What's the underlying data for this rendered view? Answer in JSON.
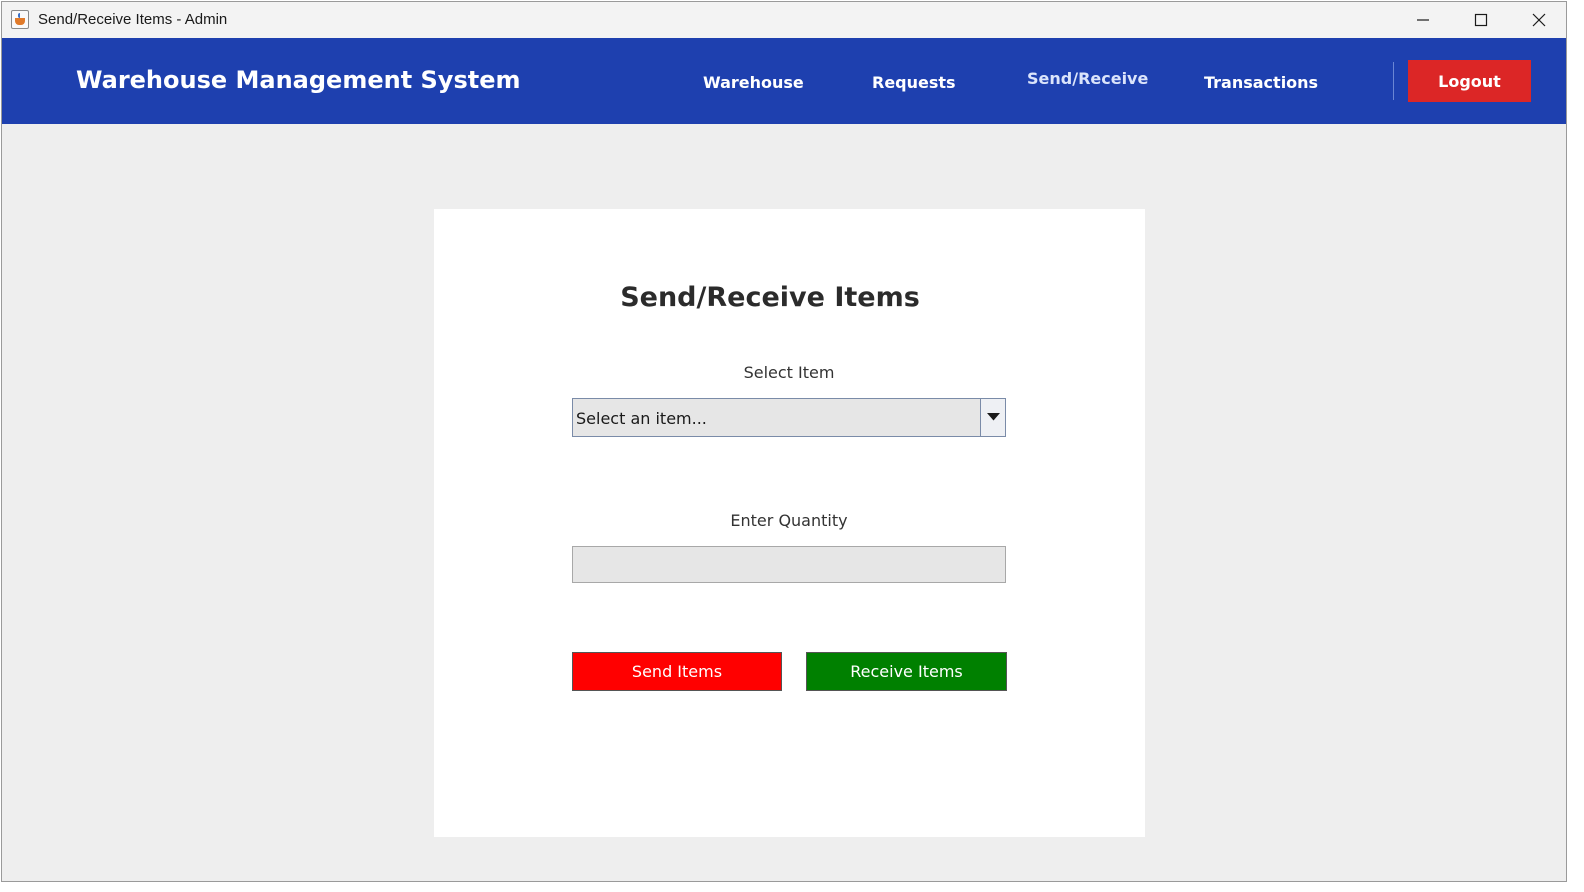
{
  "window": {
    "title": "Send/Receive Items - Admin",
    "controls": {
      "minimize_icon": "minimize-icon",
      "maximize_icon": "maximize-icon",
      "close_icon": "close-icon"
    }
  },
  "header": {
    "brand": "Warehouse Management System",
    "nav": [
      {
        "label": "Warehouse",
        "active": false
      },
      {
        "label": "Requests",
        "active": false
      },
      {
        "label": "Send/Receive",
        "active": true
      },
      {
        "label": "Transactions",
        "active": false
      }
    ],
    "logout_label": "Logout",
    "colors": {
      "header_bg": "#1e40af",
      "logout_bg": "#dc2626"
    }
  },
  "main": {
    "title": "Send/Receive Items",
    "item_select": {
      "label": "Select Item",
      "value": "Select an item...",
      "icon": "chevron-down-icon"
    },
    "quantity": {
      "label": "Enter Quantity",
      "value": "",
      "placeholder": ""
    },
    "send_label": "Send Items",
    "receive_label": "Receive Items",
    "colors": {
      "send_bg": "#ff0000",
      "receive_bg": "#008000"
    }
  }
}
